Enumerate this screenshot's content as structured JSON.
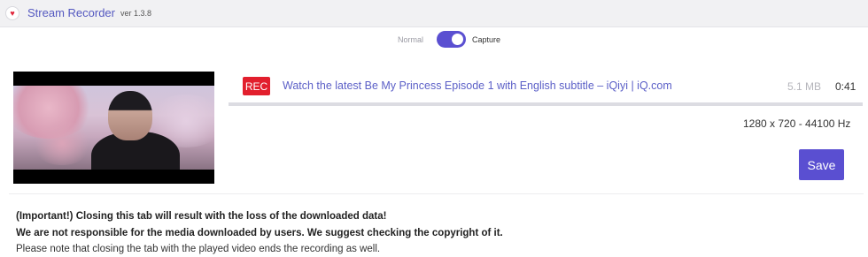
{
  "header": {
    "logo_icon": "heart-icon",
    "title": "Stream Recorder",
    "version": "ver 1.3.8"
  },
  "mode": {
    "normal_label": "Normal",
    "capture_label": "Capture",
    "capture_enabled": true,
    "toggle_color": "#5a4fd1"
  },
  "recording": {
    "badge": "REC",
    "badge_color": "#e21f2d",
    "title": "Watch the latest Be My Princess Episode 1 with English subtitle – iQiyi | iQ.com",
    "size": "5.1 MB",
    "duration": "0:41",
    "resolution": "1280 x 720 - 44100 Hz",
    "progress": 1.0
  },
  "actions": {
    "save_label": "Save",
    "accent": "#5a4fd1"
  },
  "notices": [
    "(Important!) Closing this tab will result with the loss of the downloaded data!",
    "We are not responsible for the media downloaded by users. We suggest checking the copyright of it.",
    "Please note that closing the tab with the played video ends the recording as well."
  ]
}
